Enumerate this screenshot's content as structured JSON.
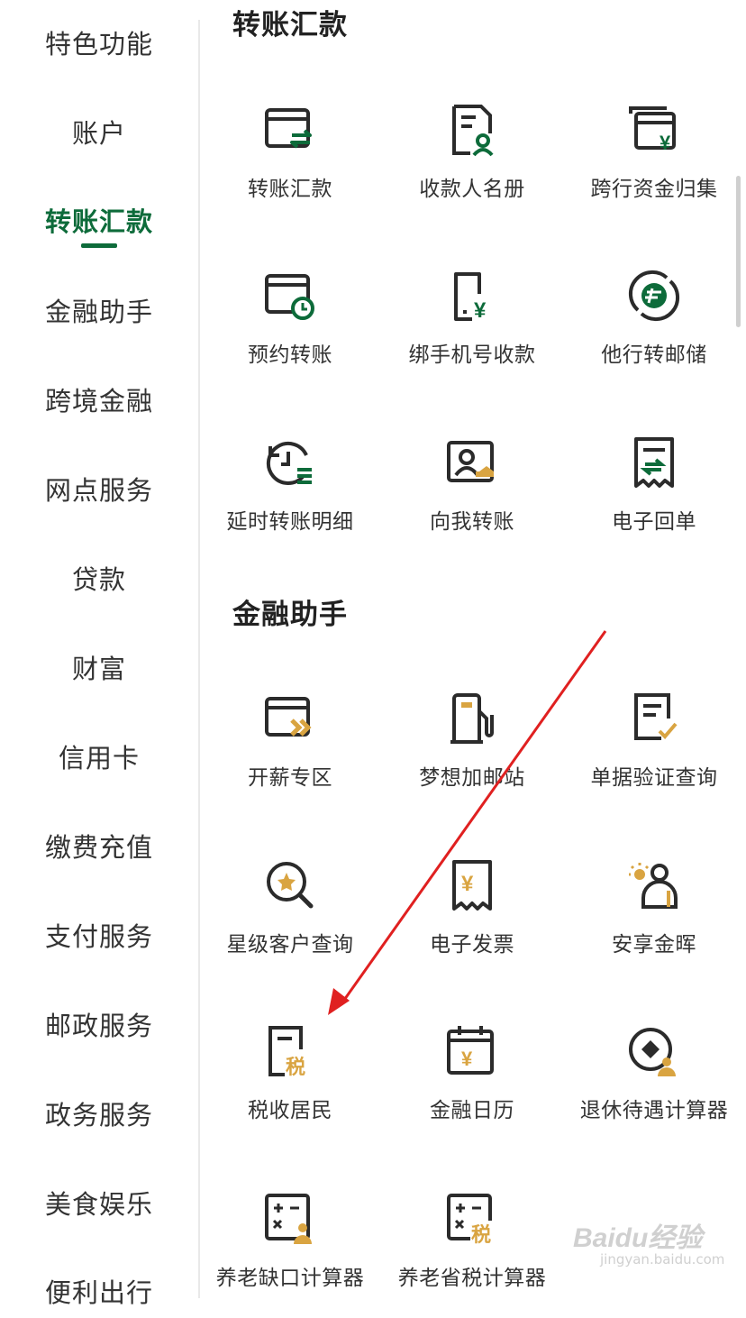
{
  "sidebar": {
    "items": [
      {
        "label": "特色功能"
      },
      {
        "label": "账户"
      },
      {
        "label": "转账汇款"
      },
      {
        "label": "金融助手"
      },
      {
        "label": "跨境金融"
      },
      {
        "label": "网点服务"
      },
      {
        "label": "贷款"
      },
      {
        "label": "财富"
      },
      {
        "label": "信用卡"
      },
      {
        "label": "缴费充值"
      },
      {
        "label": "支付服务"
      },
      {
        "label": "邮政服务"
      },
      {
        "label": "政务服务"
      },
      {
        "label": "美食娱乐"
      },
      {
        "label": "便利出行"
      }
    ],
    "active_index": 2
  },
  "sections": [
    {
      "title": "转账汇款",
      "items": [
        {
          "label": "转账汇款",
          "icon": "transfer-icon"
        },
        {
          "label": "收款人名册",
          "icon": "payee-book-icon"
        },
        {
          "label": "跨行资金归集",
          "icon": "fund-collection-icon"
        },
        {
          "label": "预约转账",
          "icon": "scheduled-transfer-icon"
        },
        {
          "label": "绑手机号收款",
          "icon": "phone-receive-icon"
        },
        {
          "label": "他行转邮储",
          "icon": "other-bank-icon"
        },
        {
          "label": "延时转账明细",
          "icon": "delayed-transfer-icon"
        },
        {
          "label": "向我转账",
          "icon": "transfer-to-me-icon"
        },
        {
          "label": "电子回单",
          "icon": "e-receipt-icon"
        }
      ]
    },
    {
      "title": "金融助手",
      "items": [
        {
          "label": "开薪专区",
          "icon": "salary-zone-icon"
        },
        {
          "label": "梦想加邮站",
          "icon": "fuel-station-icon"
        },
        {
          "label": "单据验证查询",
          "icon": "document-verify-icon"
        },
        {
          "label": "星级客户查询",
          "icon": "star-search-icon"
        },
        {
          "label": "电子发票",
          "icon": "e-invoice-icon"
        },
        {
          "label": "安享金晖",
          "icon": "senior-care-icon"
        },
        {
          "label": "税收居民",
          "icon": "tax-resident-icon"
        },
        {
          "label": "金融日历",
          "icon": "finance-calendar-icon"
        },
        {
          "label": "退休待遇计算器",
          "icon": "retirement-calc-icon"
        },
        {
          "label": "养老缺口计算器",
          "icon": "pension-gap-calc-icon"
        },
        {
          "label": "养老省税计算器",
          "icon": "pension-tax-calc-icon"
        }
      ]
    }
  ],
  "watermark": {
    "brand": "Baidu经验",
    "url": "jingyan.baidu.com"
  },
  "colors": {
    "brand_green": "#0d6b3a",
    "gold": "#d9a441",
    "icon_dark": "#2b2b2b",
    "arrow_red": "#e02020"
  }
}
